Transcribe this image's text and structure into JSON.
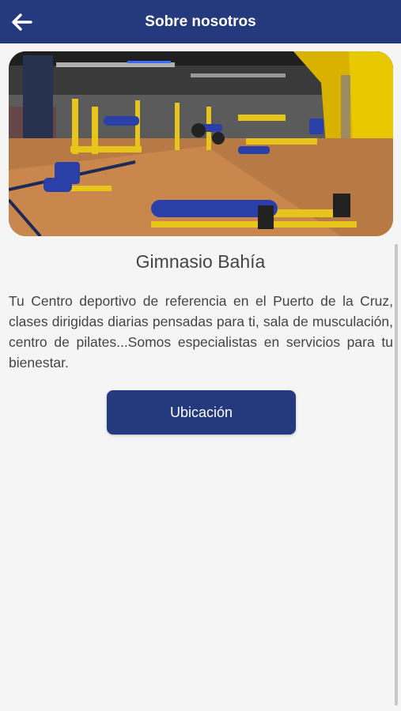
{
  "header": {
    "title": "Sobre nosotros",
    "back_icon": "arrow-left-icon",
    "background": "#253a7e"
  },
  "hero": {
    "image": "gym-interior-photo"
  },
  "gym": {
    "name": "Gimnasio Bahía",
    "description": "Tu Centro deportivo de referencia en el Puerto de la Cruz, clases dirigidas diarias pensadas para ti, sala de musculación, centro de pilates...Somos especialistas en servicios para tu bienestar."
  },
  "actions": {
    "location_label": "Ubicación"
  },
  "colors": {
    "primary": "#253a7e",
    "text": "#444444",
    "background": "#f5f5f5"
  }
}
